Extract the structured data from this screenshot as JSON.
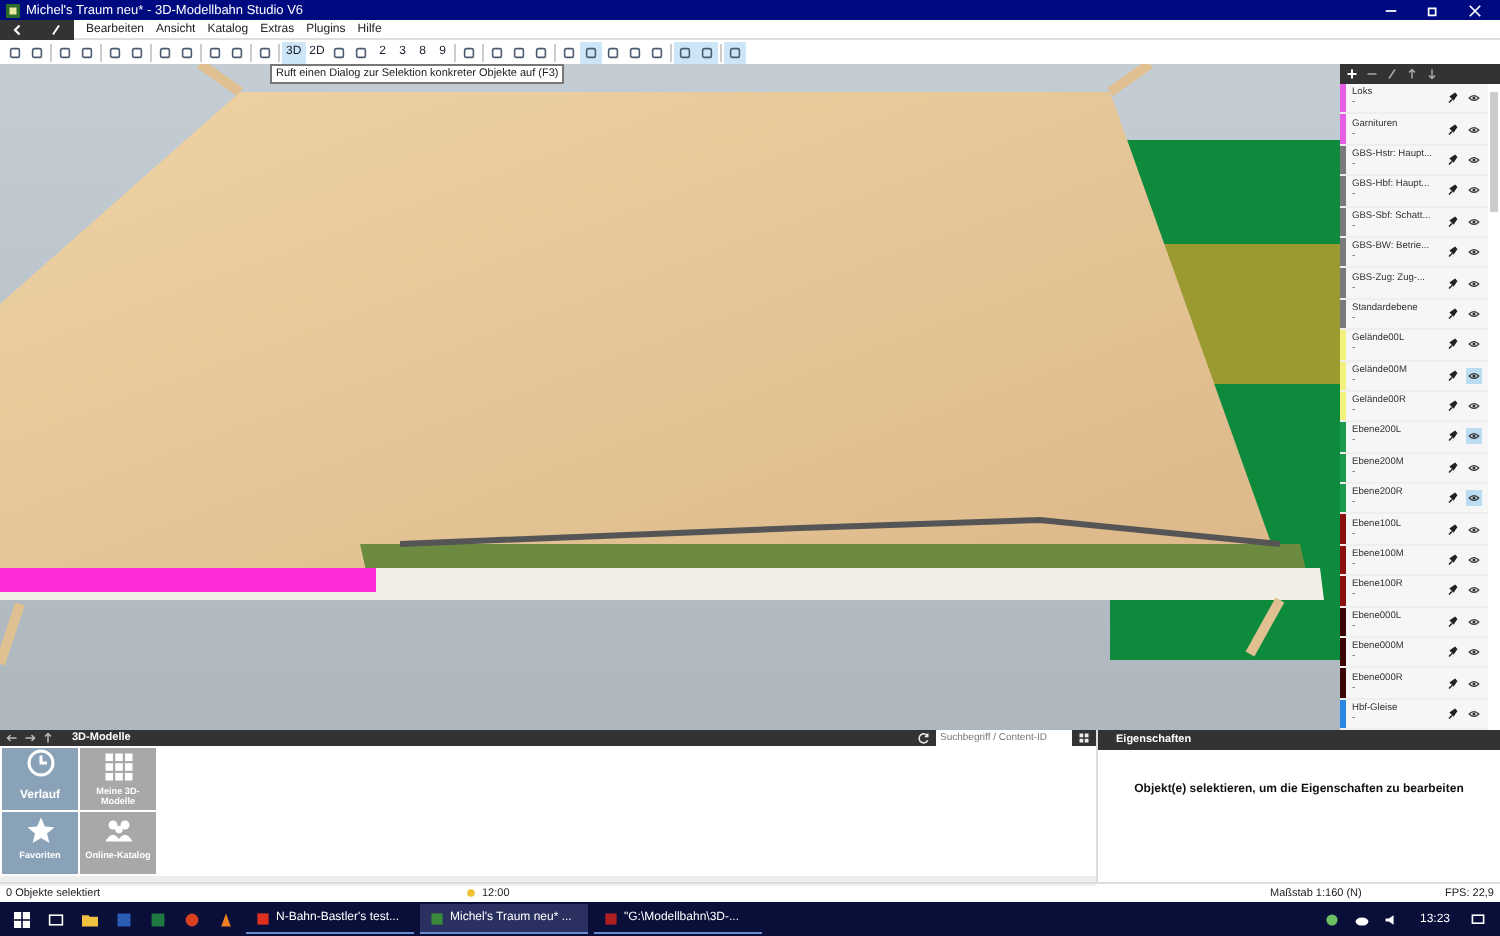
{
  "window": {
    "title": "Michel's Traum neu* - 3D-Modellbahn Studio V6"
  },
  "menu": [
    "Bearbeiten",
    "Ansicht",
    "Katalog",
    "Extras",
    "Plugins",
    "Hilfe"
  ],
  "toolbar": [
    {
      "kind": "icon",
      "selected": false
    },
    {
      "kind": "icon",
      "selected": false
    },
    {
      "kind": "icon",
      "selected": false
    },
    {
      "kind": "icon",
      "selected": false
    },
    {
      "kind": "icon",
      "selected": false
    },
    {
      "kind": "icon",
      "selected": false
    },
    {
      "kind": "icon",
      "selected": false
    },
    {
      "kind": "icon",
      "selected": false
    },
    {
      "kind": "icon",
      "selected": false
    },
    {
      "kind": "icon",
      "selected": false
    },
    {
      "kind": "icon",
      "selected": false
    },
    {
      "kind": "text",
      "label": "3D",
      "selected": true
    },
    {
      "kind": "text",
      "label": "2D",
      "selected": false
    },
    {
      "kind": "icon",
      "selected": false
    },
    {
      "kind": "icon",
      "selected": false
    },
    {
      "kind": "text",
      "label": "2",
      "selected": false
    },
    {
      "kind": "text",
      "label": "3",
      "selected": false
    },
    {
      "kind": "text",
      "label": "8",
      "selected": false
    },
    {
      "kind": "text",
      "label": "9",
      "selected": false
    },
    {
      "kind": "icon",
      "selected": false
    },
    {
      "kind": "icon",
      "selected": false
    },
    {
      "kind": "icon",
      "selected": false
    },
    {
      "kind": "icon",
      "selected": false
    },
    {
      "kind": "icon",
      "selected": false
    },
    {
      "kind": "icon",
      "selected": true
    },
    {
      "kind": "icon",
      "selected": false
    },
    {
      "kind": "icon",
      "selected": false
    },
    {
      "kind": "icon",
      "selected": false
    },
    {
      "kind": "icon",
      "selected": true
    },
    {
      "kind": "icon",
      "selected": true
    },
    {
      "kind": "icon",
      "selected": true
    }
  ],
  "tooltip": "Ruft einen Dialog zur Selektion konkreter Objekte auf (F3)",
  "layers": [
    {
      "name": "Loks",
      "detail": "-",
      "color": "#e55ee5",
      "highlighted": false
    },
    {
      "name": "Garnituren",
      "detail": "-",
      "color": "#e55ee5",
      "highlighted": false
    },
    {
      "name": "GBS-Hstr: Haupt...",
      "detail": "-",
      "color": "#7a7a7a",
      "highlighted": false
    },
    {
      "name": "GBS-Hbf: Haupt...",
      "detail": "-",
      "color": "#7a7a7a",
      "highlighted": false
    },
    {
      "name": "GBS-Sbf: Schatt...",
      "detail": "-",
      "color": "#7a7a7a",
      "highlighted": false
    },
    {
      "name": "GBS-BW: Betrie...",
      "detail": "-",
      "color": "#7a7a7a",
      "highlighted": false
    },
    {
      "name": "GBS-Zug: Zug-...",
      "detail": "-",
      "color": "#7a7a7a",
      "highlighted": false
    },
    {
      "name": "Standardebene",
      "detail": "-",
      "color": "#7a7a7a",
      "highlighted": false
    },
    {
      "name": "Gelände00L",
      "detail": "-",
      "color": "#f2f27a",
      "highlighted": false
    },
    {
      "name": "Gelände00M",
      "detail": "-",
      "color": "#f2f27a",
      "highlighted": true
    },
    {
      "name": "Gelände00R",
      "detail": "-",
      "color": "#f2f27a",
      "highlighted": false
    },
    {
      "name": "Ebene200L",
      "detail": "-",
      "color": "#1a9a4a",
      "highlighted": true
    },
    {
      "name": "Ebene200M",
      "detail": "-",
      "color": "#1a9a4a",
      "highlighted": false
    },
    {
      "name": "Ebene200R",
      "detail": "-",
      "color": "#1a9a4a",
      "highlighted": true
    },
    {
      "name": "Ebene100L",
      "detail": "-",
      "color": "#8a1010",
      "highlighted": false
    },
    {
      "name": "Ebene100M",
      "detail": "-",
      "color": "#8a1010",
      "highlighted": false
    },
    {
      "name": "Ebene100R",
      "detail": "-",
      "color": "#8a1010",
      "highlighted": false
    },
    {
      "name": "Ebene000L",
      "detail": "-",
      "color": "#3c0505",
      "highlighted": false
    },
    {
      "name": "Ebene000M",
      "detail": "-",
      "color": "#3c0505",
      "highlighted": false
    },
    {
      "name": "Ebene000R",
      "detail": "-",
      "color": "#3c0505",
      "highlighted": false
    },
    {
      "name": "Hbf-Gleise",
      "detail": "-",
      "color": "#2a86e0",
      "highlighted": false
    }
  ],
  "models_panel": {
    "title": "3D-Modelle",
    "search": {
      "placeholder": "Suchbegriff / Content-ID"
    },
    "tiles": [
      {
        "label": "Verlauf",
        "kind": "clock"
      },
      {
        "label": "Meine 3D-Modelle",
        "kind": "grid"
      },
      {
        "label": "Favoriten",
        "kind": "star"
      },
      {
        "label": "Online-Katalog",
        "kind": "people"
      }
    ]
  },
  "properties_panel": {
    "title": "Eigenschaften",
    "message": "Objekt(e) selektieren, um die Eigenschaften zu bearbeiten"
  },
  "status_bar": {
    "selection": "0 Objekte selektiert",
    "time": "12:00",
    "scale": "Maßstab 1:160 (N)",
    "fps": "FPS: 22,9"
  },
  "taskbar": {
    "tasks": [
      {
        "label": "N-Bahn-Bastler's test...",
        "selected": false
      },
      {
        "label": "Michel's Traum neu* ...",
        "selected": true
      },
      {
        "label": "\"G:\\Modellbahn\\3D-...",
        "selected": false
      }
    ],
    "clock": "13:23"
  }
}
